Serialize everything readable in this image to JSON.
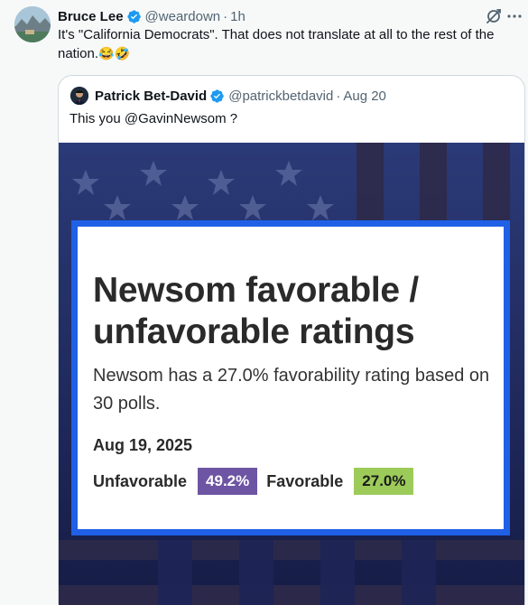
{
  "tweet": {
    "author_name": "Bruce Lee",
    "handle": "@weardown",
    "separator": "·",
    "time": "1h",
    "text": "It's \"California Democrats\". That does not translate at all to the rest of the nation.",
    "emojis": "😂🤣"
  },
  "quote": {
    "author_name": "Patrick Bet-David",
    "handle": "@patrickbetdavid",
    "separator": "·",
    "date": "Aug 20",
    "text": "This you @GavinNewsom ?"
  },
  "media_card": {
    "title": "Newsom favorable / unfavorable ratings",
    "subtitle": "Newsom has a 27.0% favorability rating based on 30 polls.",
    "date": "Aug 19, 2025",
    "unfavorable_label": "Unfavorable",
    "unfavorable_value": "49.2%",
    "favorable_label": "Favorable",
    "favorable_value": "27.0%"
  },
  "colors": {
    "verified": "#1d9bf0",
    "unfavorable_badge": "#6e55a3",
    "favorable_badge": "#9ccb5a",
    "card_border": "#1f60e6"
  },
  "icons": {
    "grok": "grok-icon",
    "more": "more-icon",
    "verified": "verified-badge-icon"
  }
}
